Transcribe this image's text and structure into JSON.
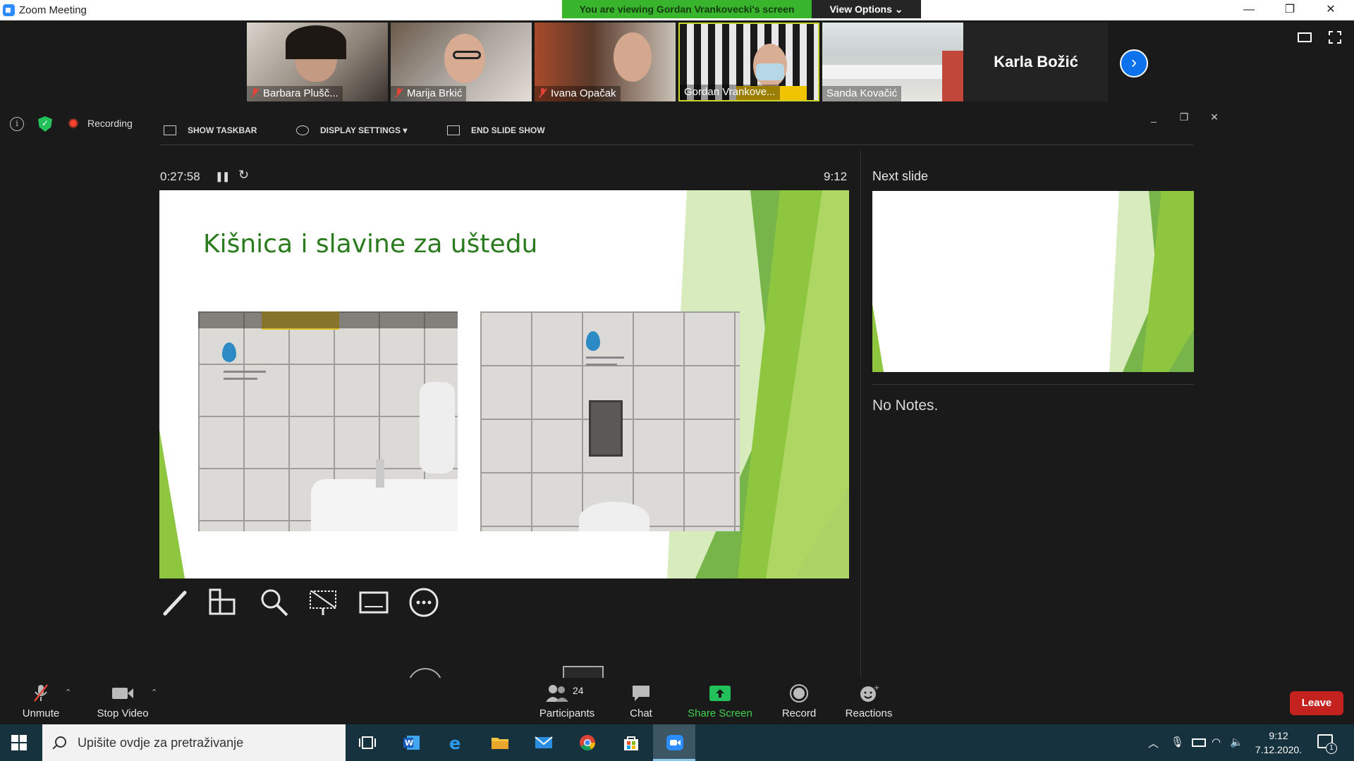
{
  "window": {
    "title": "Zoom Meeting",
    "banner": "You are viewing Gordan Vrankovecki's screen",
    "view_options": "View Options ⌄",
    "minimize": "—",
    "restore": "❐",
    "close": "✕"
  },
  "participants_strip": [
    {
      "name": "Barbara Plušč...",
      "muted": true
    },
    {
      "name": "Marija Brkić",
      "muted": true
    },
    {
      "name": "Ivana Opačak",
      "muted": true
    },
    {
      "name": "Gordan Vrankove...",
      "muted": false
    },
    {
      "name": "Sanda Kovačić",
      "muted": false
    }
  ],
  "karla_tile": "Karla Božić",
  "status": {
    "recording": "Recording"
  },
  "presenter_toolbar": {
    "show_taskbar": "SHOW TASKBAR",
    "display_settings": "DISPLAY SETTINGS ▾",
    "end_slide_show": "END SLIDE SHOW"
  },
  "presenter": {
    "timer": "0:27:58",
    "clock": "9:12",
    "next_slide_label": "Next slide",
    "notes": "No Notes."
  },
  "slide": {
    "title": "Kišnica i slavine za uštedu"
  },
  "zoom_bar": {
    "unmute": "Unmute",
    "stop_video": "Stop Video",
    "participants": "Participants",
    "participants_count": "24",
    "chat": "Chat",
    "share_screen": "Share Screen",
    "record": "Record",
    "reactions": "Reactions",
    "leave": "Leave"
  },
  "taskbar": {
    "search_placeholder": "Upišite ovdje za pretraživanje",
    "time": "9:12",
    "date": "7.12.2020.",
    "notification_count": "1"
  },
  "colors": {
    "zoom_blue": "#0e72ed",
    "banner_green": "#38b52c",
    "leave_red": "#c4221f",
    "slide_title_green": "#2a7a1e"
  }
}
